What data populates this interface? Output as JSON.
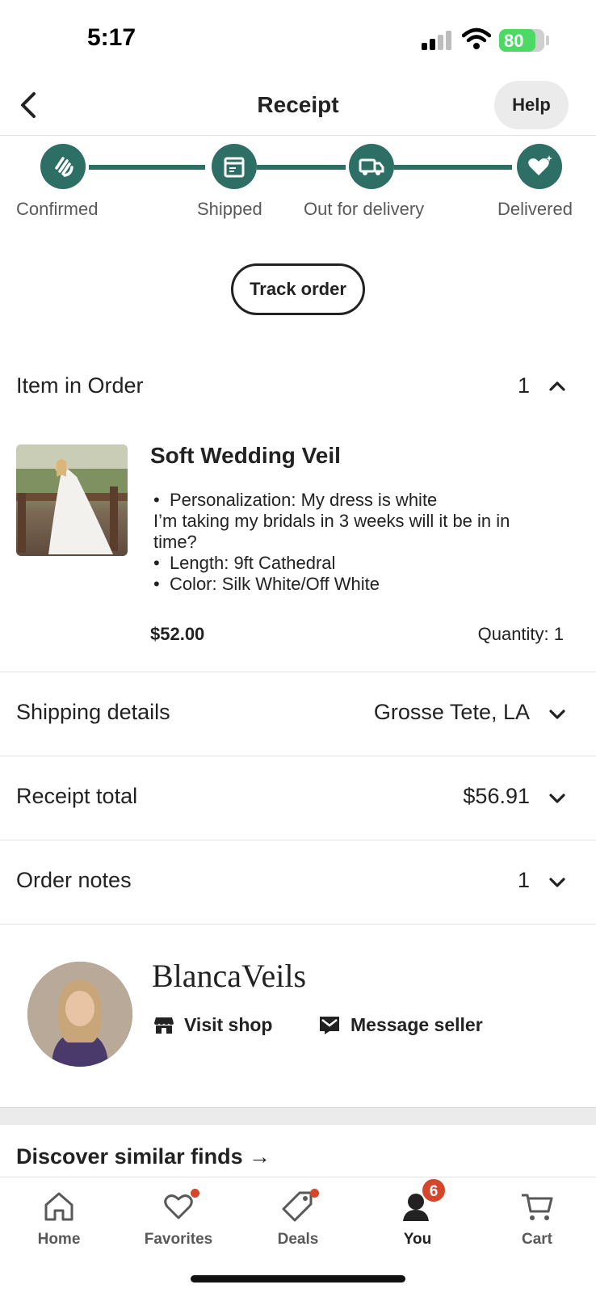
{
  "status_bar": {
    "time": "5:17",
    "battery": "80",
    "battery_level": 0.8
  },
  "header": {
    "title": "Receipt",
    "help_label": "Help"
  },
  "progress": {
    "steps": [
      {
        "label": "Confirmed",
        "icon": "hand-wave-icon"
      },
      {
        "label": "Shipped",
        "icon": "package-icon"
      },
      {
        "label": "Out for delivery",
        "icon": "truck-icon"
      },
      {
        "label": "Delivered",
        "icon": "heart-sparkle-icon"
      }
    ],
    "track_label": "Track order",
    "color": "#2d6e65"
  },
  "items_section": {
    "label": "Item in Order",
    "count": "1"
  },
  "item": {
    "title": "Soft Wedding Veil",
    "personalization": "Personalization:  My dress is white",
    "personalization_cont": "I’m taking my bridals in 3 weeks will it be in in time?",
    "length": "Length: 9ft Cathedral",
    "color": "Color: Silk White/Off White",
    "price": "$52.00",
    "quantity": "Quantity: 1"
  },
  "shipping": {
    "label": "Shipping details",
    "value": "Grosse Tete, LA"
  },
  "receipt_total": {
    "label": "Receipt total",
    "value": "$56.91"
  },
  "order_notes": {
    "label": "Order notes",
    "count": "1"
  },
  "seller": {
    "name": "BlancaVeils",
    "visit_label": "Visit shop",
    "message_label": "Message seller"
  },
  "discover": {
    "label": "Discover similar finds →"
  },
  "tabs": [
    {
      "label": "Home",
      "icon": "home-icon"
    },
    {
      "label": "Favorites",
      "icon": "heart-icon"
    },
    {
      "label": "Deals",
      "icon": "tag-icon"
    },
    {
      "label": "You",
      "icon": "person-icon",
      "badge": "6"
    },
    {
      "label": "Cart",
      "icon": "cart-icon"
    }
  ],
  "colors": {
    "accent": "#2d6e65",
    "badge": "#d5462b"
  }
}
